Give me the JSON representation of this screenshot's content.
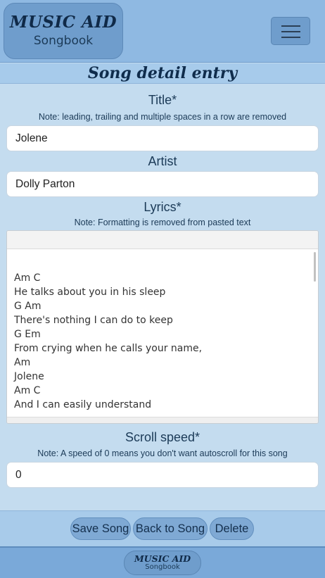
{
  "header": {
    "logo_title": "MUSIC AID",
    "logo_subtitle": "Songbook",
    "menu_icon": "hamburger-icon"
  },
  "page": {
    "title": "Song detail entry"
  },
  "form": {
    "title": {
      "label": "Title*",
      "note": "Note: leading, trailing and multiple spaces in a row are removed",
      "value": "Jolene"
    },
    "artist": {
      "label": "Artist",
      "value": "Dolly Parton"
    },
    "lyrics": {
      "label": "Lyrics*",
      "note": "Note: Formatting is removed from pasted text",
      "lines": [
        "Am C",
        "He talks about you in his sleep",
        "G Am",
        "There's nothing I can do to keep",
        "G Em",
        "From crying when he calls your name,",
        "Am",
        "Jolene",
        "Am C",
        "And I can easily understand"
      ]
    },
    "scroll_speed": {
      "label": "Scroll speed*",
      "note": "Note: A speed of 0 means you don't want autoscroll for this song",
      "value": "0"
    }
  },
  "actions": {
    "save": "Save Song",
    "back": "Back to Song",
    "delete": "Delete"
  },
  "footer": {
    "logo_title": "MUSIC AID",
    "logo_subtitle": "Songbook"
  },
  "colors": {
    "background": "#c4dcef",
    "header": "#8fb9e2",
    "accent": "#6f9dcc",
    "text": "#1b3a57"
  }
}
